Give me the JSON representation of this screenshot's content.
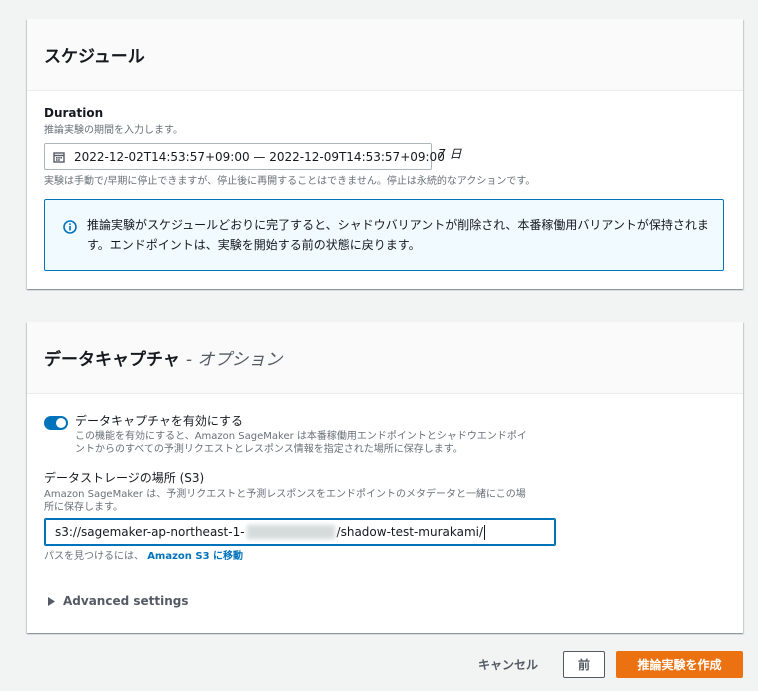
{
  "schedule": {
    "title": "スケジュール",
    "duration_label": "Duration",
    "duration_desc": "推論実験の期間を入力します。",
    "date_range": "2022-12-02T14:53:57+09:00 — 2022-12-09T14:53:57+09:00",
    "days": "7 日",
    "stop_note": "実験は手動で/早期に停止できますが、停止後に再開することはできません。停止は永続的なアクションです。",
    "info_text": "推論実験がスケジュールどおりに完了すると、シャドウバリアントが削除され、本番稼働用バリアントが保持されます。エンドポイントは、実験を開始する前の状態に戻ります。"
  },
  "data_capture": {
    "title": "データキャプチャ",
    "title_suffix": "- オプション",
    "toggle_label": "データキャプチャを有効にする",
    "toggle_on": true,
    "toggle_desc_1": "この機能を有効にすると、Amazon SageMaker は本番稼働用エンドポイントとシャドウエンドポイ",
    "toggle_desc_2": "ントからのすべての予測リクエストとレスポンス情報を指定された場所に保存します。",
    "storage_label": "データストレージの場所 (S3)",
    "storage_desc_1": "Amazon SageMaker は、予測リクエストと予測レスポンスをエンドポイントのメタデータと一緒にこの場",
    "storage_desc_2": "所に保存します。",
    "s3_prefix": "s3://sagemaker-ap-northeast-1-",
    "s3_suffix": "/shadow-test-murakami/",
    "find_path_text": "パスを見つけるには、",
    "find_path_link": "Amazon S3 に移動",
    "advanced_label": "Advanced settings"
  },
  "footer": {
    "cancel": "キャンセル",
    "previous": "前",
    "create": "推論実験を作成"
  },
  "colors": {
    "accent": "#0073bb",
    "primary_button": "#ec7211",
    "info_bg": "#f1faff"
  }
}
